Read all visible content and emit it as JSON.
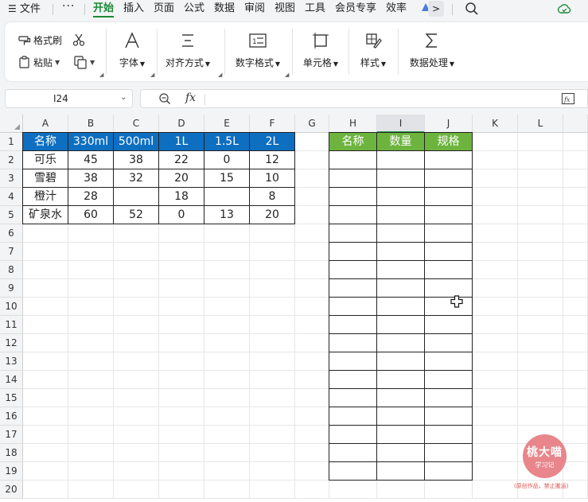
{
  "menu": {
    "file": "文件",
    "more": "···",
    "tabs": [
      "开始",
      "插入",
      "页面",
      "公式",
      "数据",
      "审阅",
      "视图",
      "工具",
      "会员专享",
      "效率"
    ],
    "active_tab": "开始",
    "chevron": ">"
  },
  "ribbon": {
    "format_painter": "格式刷",
    "paste": "粘贴",
    "font": "字体",
    "align": "对齐方式",
    "number_format": "数字格式",
    "cell": "单元格",
    "style": "样式",
    "data_processing": "数据处理"
  },
  "formula_bar": {
    "name_box": "I24",
    "fx": "fx",
    "formula": ""
  },
  "sheet": {
    "columns": [
      "A",
      "B",
      "C",
      "D",
      "E",
      "F",
      "G",
      "H",
      "I",
      "J",
      "K",
      "L"
    ],
    "selected_column": "I",
    "rows": [
      "1",
      "2",
      "3",
      "4",
      "5",
      "6",
      "7",
      "8",
      "9",
      "10",
      "11",
      "12",
      "13",
      "14",
      "15",
      "16",
      "17",
      "18",
      "19",
      "20"
    ],
    "table1": {
      "headers": [
        "名称",
        "330ml",
        "500ml",
        "1L",
        "1.5L",
        "2L"
      ],
      "rows": [
        [
          "可乐",
          "45",
          "38",
          "22",
          "0",
          "12"
        ],
        [
          "雪碧",
          "38",
          "32",
          "20",
          "15",
          "10"
        ],
        [
          "橙汁",
          "28",
          "",
          "18",
          "",
          "8"
        ],
        [
          "矿泉水",
          "60",
          "52",
          "0",
          "13",
          "20"
        ]
      ]
    },
    "table2": {
      "headers": [
        "名称",
        "数量",
        "规格"
      ],
      "row_count": 18
    }
  },
  "colors": {
    "accent": "#1a8a35",
    "header_blue": "#0e6fc1",
    "header_green": "#6db43f",
    "stamp": "#e8868b"
  },
  "watermark": {
    "title": "桃大喵",
    "subtitle": "学习记",
    "note": "(原创作品，禁止搬运)"
  }
}
